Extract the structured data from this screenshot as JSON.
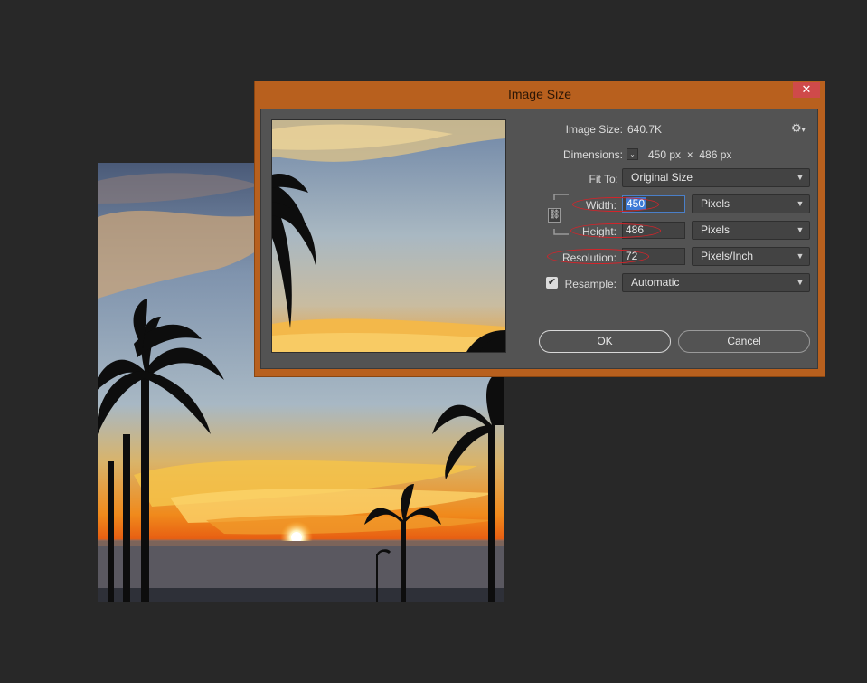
{
  "dialog": {
    "title": "Image Size",
    "close_glyph": "✕",
    "image_size_label": "Image Size:",
    "image_size_value": "640.7K",
    "dimensions_label": "Dimensions:",
    "dimensions_value": "450 px  ×  486 px",
    "fit_to_label": "Fit To:",
    "fit_to_value": "Original Size",
    "width_label": "Width:",
    "width_value": "450",
    "width_unit": "Pixels",
    "height_label": "Height:",
    "height_value": "486",
    "height_unit": "Pixels",
    "resolution_label": "Resolution:",
    "resolution_value": "72",
    "resolution_unit": "Pixels/Inch",
    "resample_label": "Resample:",
    "resample_checked": true,
    "resample_value": "Automatic",
    "ok_label": "OK",
    "cancel_label": "Cancel",
    "gear_icon": "gear-icon",
    "link_icon": "chain-link-icon"
  },
  "colors": {
    "dialog_frame": "#b8601e",
    "panel": "#535353",
    "canvas_bg": "#282828",
    "annotation": "#d3242a",
    "selection": "#3d7ad6"
  }
}
